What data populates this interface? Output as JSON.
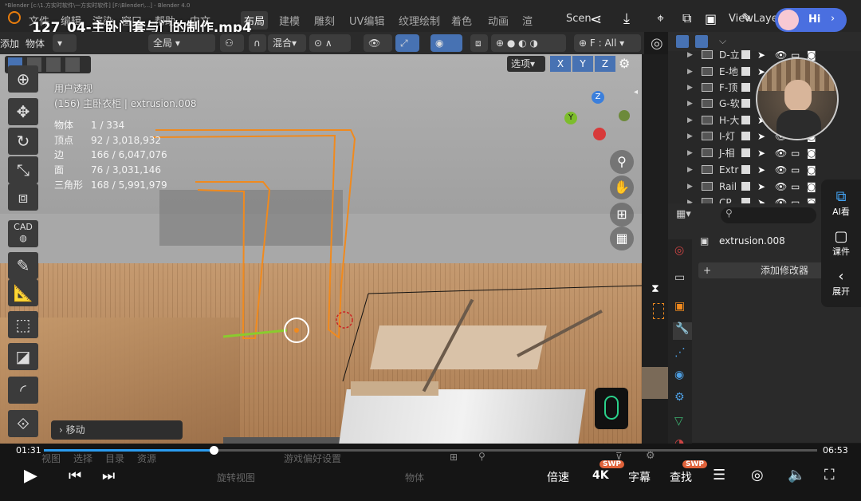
{
  "topbar": {
    "window_title": "*Blender [c:\\1.方实时软件\\一方实时软件]  [F:\\Blender\\...]  - Blender 4.0",
    "video_title": "127_04-主卧门套与门的制作.mp4",
    "menu": [
      "文件",
      "编辑",
      "渲染",
      "窗口",
      "帮助",
      "中文"
    ],
    "workspaces": [
      "布局",
      "建模",
      "雕刻",
      "UV编辑",
      "纹理绘制",
      "着色",
      "动画",
      "渲"
    ],
    "active_workspace": "布局",
    "scene_label": "Scen",
    "view_layer_label": "ViewLayer",
    "hi_label": "Hi"
  },
  "header2": {
    "add_label": "添加",
    "object_label": "物体",
    "transform_orientation": "全局",
    "blend_label": "混合",
    "snap_label": "F : All",
    "options_label": "选项",
    "axes": [
      "X",
      "Y",
      "Z"
    ]
  },
  "viewport": {
    "view_name": "用户透视",
    "object_info": "(156) 主卧衣柜 | extrusion.008",
    "stats": [
      {
        "k": "物体",
        "v": "1 / 334"
      },
      {
        "k": "顶点",
        "v": "92 / 3,018,932"
      },
      {
        "k": "边",
        "v": "166 / 6,047,076"
      },
      {
        "k": "面",
        "v": "76 / 3,031,146"
      },
      {
        "k": "三角形",
        "v": "168 / 5,991,979"
      }
    ],
    "cad_label": "CAD",
    "move_label": "移动",
    "gizmo": {
      "x": "X",
      "y": "Y",
      "z": "Z"
    }
  },
  "outliner": {
    "rows": [
      "D-立",
      "E-地",
      "F-顶",
      "G-软",
      "H-大",
      "I-灯",
      "J-相",
      "Extr",
      "Rail",
      "CP"
    ]
  },
  "properties": {
    "object_name": "extrusion.008",
    "add_modifier": "添加修改器"
  },
  "ai_panel": {
    "items": [
      "AI看",
      "课件",
      "展开"
    ]
  },
  "player": {
    "current_time": "01:31",
    "total_time": "06:53",
    "progress": 0.22,
    "speed_label": "倍速",
    "quality_label": "4K",
    "subtitle_label": "字幕",
    "search_label": "查找",
    "swp_badge": "SWP"
  },
  "statusbar": {
    "items": [
      "视图",
      "选择",
      "目录",
      "资源"
    ],
    "prefs": "游戏偏好设置",
    "pan": "旋转视图",
    "obj": "物体"
  },
  "colors": {
    "accent_blue": "#4772b3",
    "selection_orange": "#f08a1e",
    "progress_blue": "#2b9cf0"
  }
}
